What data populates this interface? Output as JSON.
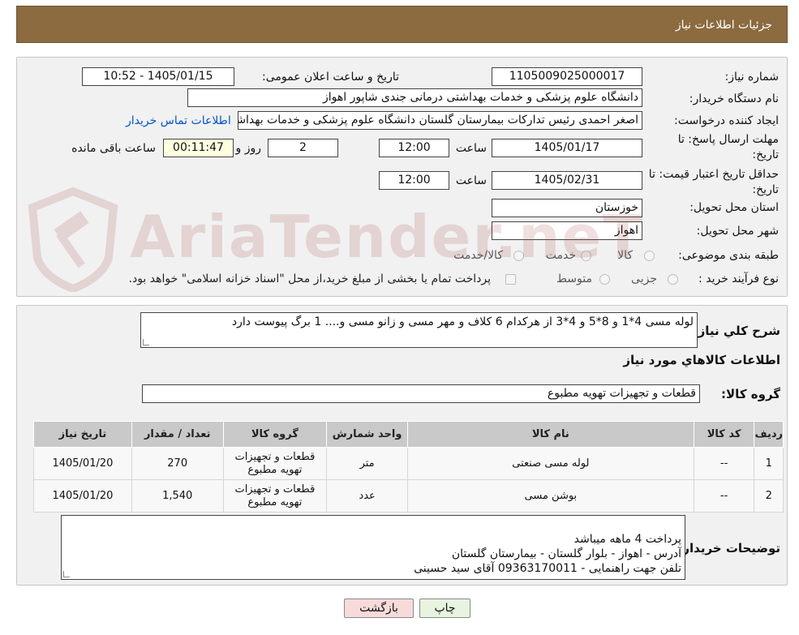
{
  "header": {
    "title": "جزئیات اطلاعات نیاز"
  },
  "fields": {
    "need_number_label": "شماره نیاز:",
    "need_number": "1105009025000017",
    "announce_label": "تاریخ و ساعت اعلان عمومی:",
    "announce_value": "1405/01/15 - 10:52",
    "buyer_org_label": "نام دستگاه خریدار:",
    "buyer_org": "دانشگاه علوم پزشکی و خدمات بهداشتی درمانی جندی شاپور اهواز",
    "creator_label": "ایجاد کننده درخواست:",
    "creator": "اصغر احمدی رئیس تدارکات بیمارستان گلستان دانشگاه علوم پزشکی و خدمات بهداشتی",
    "contact_link": "اطلاعات تماس خریدار",
    "deadline_label_1": "مهلت ارسال پاسخ: تا",
    "deadline_label_2": "تاریخ:",
    "deadline_date": "1405/01/17",
    "time_label": "ساعت",
    "deadline_time": "12:00",
    "days_value": "2",
    "days_label": "روز و",
    "remaining_time": "00:11:47",
    "remaining_label": "ساعت باقی مانده",
    "validity_label_1": "حداقل تاریخ اعتبار قیمت: تا",
    "validity_label_2": "تاریخ:",
    "validity_date": "1405/02/31",
    "validity_time_label": "ساعت",
    "validity_time": "12:00",
    "province_label": "استان محل تحویل:",
    "province": "خوزستان",
    "city_label": "شهر محل تحویل:",
    "city": "اهواز",
    "category_label": "طبقه بندی موضوعی:",
    "category_options": [
      "کالا",
      "خدمت",
      "کالا/خدمت"
    ],
    "process_label": "نوع فرآیند خرید :",
    "process_options": [
      "جزیی",
      "متوسط"
    ],
    "payment_note": "پرداخت تمام یا بخشی از مبلغ خرید،از محل \"اسناد خزانه اسلامی\" خواهد بود."
  },
  "summary": {
    "label": "شرح کلي نياز:",
    "text": "لوله مسی 4*1 و 8*5 و 4*3 از هرکدام 6 کلاف و مهر مسی و زانو مسی و.... 1 برگ پیوست دارد"
  },
  "goods": {
    "title": "اطلاعات کالاهاي مورد نياز",
    "group_label": "گروه کالا:",
    "group_value": "قطعات و تجهیزات تهویه مطبوع",
    "columns": [
      "ردیف",
      "کد کالا",
      "نام کالا",
      "واحد شمارش",
      "گروه کالا",
      "تعداد / مقدار",
      "تاریخ نیاز"
    ],
    "rows": [
      {
        "index": "1",
        "code": "--",
        "name": "لوله مسی صنعتی",
        "unit": "متر",
        "group": "قطعات و تجهیزات تهویه مطبوع",
        "qty": "270",
        "date": "1405/01/20"
      },
      {
        "index": "2",
        "code": "--",
        "name": "بوشن مسی",
        "unit": "عدد",
        "group": "قطعات و تجهیزات تهویه مطبوع",
        "qty": "1,540",
        "date": "1405/01/20"
      }
    ]
  },
  "buyer_notes": {
    "label": "توضیحات خریدار:",
    "text": "پرداخت 4 ماهه میباشد\nآدرس - اهواز - بلوار گلستان - بیمارستان گلستان\nتلفن جهت راهنمایی - 09363170011 آقای سید حسینی"
  },
  "buttons": {
    "print": "چاپ",
    "back": "بازگشت"
  },
  "watermark": {
    "text": "AriaTender.neT",
    "icon": "gavel-shield-icon"
  }
}
